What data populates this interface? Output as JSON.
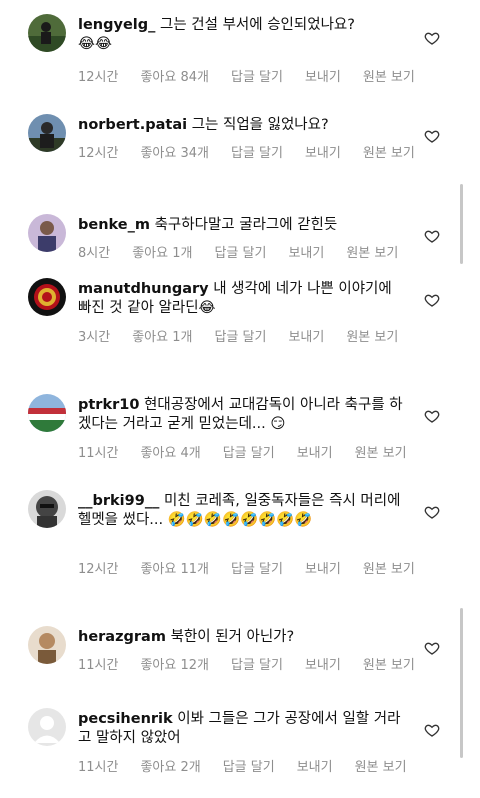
{
  "comments": [
    {
      "username": "lengyelg_",
      "text": "그는 건설 부서에 승인되었나요?",
      "emojis": [
        "😂",
        "😂"
      ],
      "time": "12시간",
      "likes": "좋아요 84개",
      "reply": "답글 달기",
      "send": "보내기",
      "translate": "원본 보기"
    },
    {
      "username": "norbert.patai",
      "text": "그는 직업을 잃었나요?",
      "emojis": [],
      "time": "12시간",
      "likes": "좋아요 34개",
      "reply": "답글 달기",
      "send": "보내기",
      "translate": "원본 보기"
    },
    {
      "username": "benke_m",
      "text": "축구하다말고 굴라그에 갇힌듯",
      "emojis": [],
      "time": "8시간",
      "likes": "좋아요 1개",
      "reply": "답글 달기",
      "send": "보내기",
      "translate": "원본 보기"
    },
    {
      "username": "manutdhungary",
      "text": "내 생각에 네가 나쁜 이야기에 빠진 것 같아 알라딘",
      "emojis": [
        "😂"
      ],
      "time": "3시간",
      "likes": "좋아요 1개",
      "reply": "답글 달기",
      "send": "보내기",
      "translate": "원본 보기"
    },
    {
      "username": "ptrkr10",
      "text": "현대공장에서 교대감독이 아니라 축구를 하겠다는 거라고 굳게 믿었는데...",
      "emojis": [
        "😏"
      ],
      "time": "11시간",
      "likes": "좋아요 4개",
      "reply": "답글 달기",
      "send": "보내기",
      "translate": "원본 보기"
    },
    {
      "username": "__brki99__",
      "text": "미친 코레족, 일중독자들은 즉시 머리에 헬멧을 썼다...",
      "emojis": [
        "🤣",
        "🤣",
        "🤣",
        "🤣",
        "🤣",
        "🤣",
        "🤣",
        "🤣"
      ],
      "time": "12시간",
      "likes": "좋아요 11개",
      "reply": "답글 달기",
      "send": "보내기",
      "translate": "원본 보기"
    },
    {
      "username": "herazgram",
      "text": "북한이 된거 아닌가?",
      "emojis": [],
      "time": "11시간",
      "likes": "좋아요 12개",
      "reply": "답글 달기",
      "send": "보내기",
      "translate": "원본 보기"
    },
    {
      "username": "pecsihenrik",
      "text": "이봐 그들은 그가 공장에서 일할 거라고 말하지 않았어",
      "emojis": [],
      "time": "11시간",
      "likes": "좋아요 2개",
      "reply": "답글 달기",
      "send": "보내기",
      "translate": "원본 보기"
    }
  ],
  "colors": {
    "meta": "#8e8e8e",
    "emoji": "#f5c20c"
  }
}
